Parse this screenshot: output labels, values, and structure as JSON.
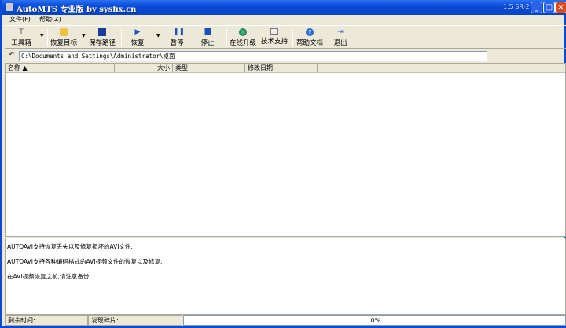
{
  "title": "AutoMTS 专业版 by sysfix.cn",
  "version": "1.5 SR-2",
  "menu": [
    "文件(F)",
    "帮助(Z)"
  ],
  "toolbar": {
    "toolbox": "工具箱",
    "restore_target": "恢复目标",
    "save_path": "保存路径",
    "restore": "恢复",
    "pause": "暂停",
    "stop": "停止",
    "online_upgrade": "在线升级",
    "tech_support": "技术支持",
    "help_doc": "帮助文档",
    "exit": "退出"
  },
  "path": "C:\\Documents and Settings\\Administrator\\桌面",
  "columns": [
    "名称",
    "大小",
    "类型",
    "修改日期"
  ],
  "info_lines": [
    "AUTOAVI支持恢复丢失以及修复损坏的AVI文件.",
    "AUTOAVI支持各种编码格式的AVI视频文件的恢复以及修复.",
    "在AVI视频恢复之前,请注意备份..."
  ],
  "status": {
    "remaining_label": "剩余时间:",
    "found_label": "发现碎片:",
    "progress": "0%",
    "progress_value": 0
  }
}
